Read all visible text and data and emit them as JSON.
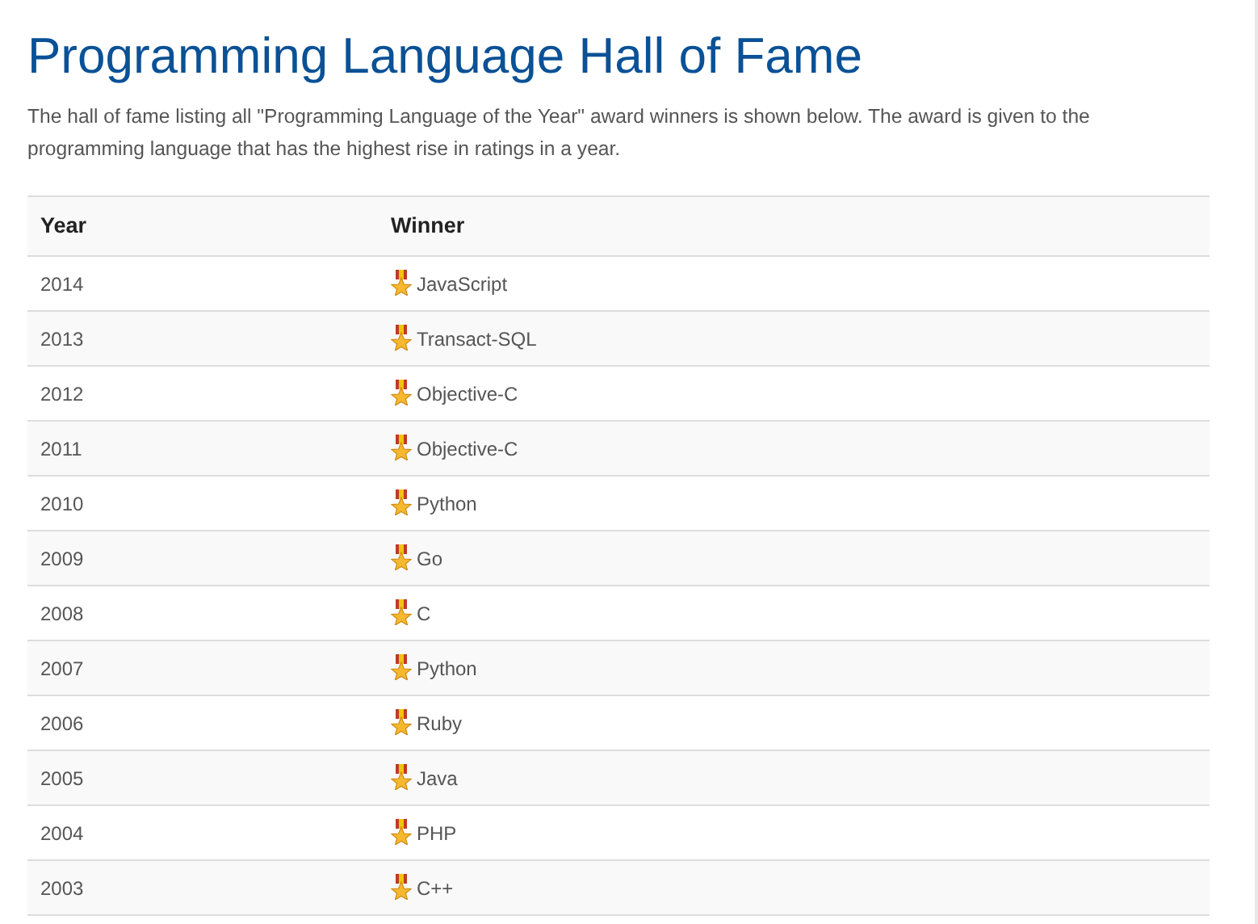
{
  "title": "Programming Language Hall of Fame",
  "intro": "The hall of fame listing all \"Programming Language of the Year\" award winners is shown below. The award is given to the programming language that has the highest rise in ratings in a year.",
  "table": {
    "columns": [
      "Year",
      "Winner"
    ],
    "rows": [
      {
        "year": "2014",
        "winner": "JavaScript"
      },
      {
        "year": "2013",
        "winner": "Transact-SQL"
      },
      {
        "year": "2012",
        "winner": "Objective-C"
      },
      {
        "year": "2011",
        "winner": "Objective-C"
      },
      {
        "year": "2010",
        "winner": "Python"
      },
      {
        "year": "2009",
        "winner": "Go"
      },
      {
        "year": "2008",
        "winner": "C"
      },
      {
        "year": "2007",
        "winner": "Python"
      },
      {
        "year": "2006",
        "winner": "Ruby"
      },
      {
        "year": "2005",
        "winner": "Java"
      },
      {
        "year": "2004",
        "winner": "PHP"
      },
      {
        "year": "2003",
        "winner": "C++"
      }
    ]
  }
}
